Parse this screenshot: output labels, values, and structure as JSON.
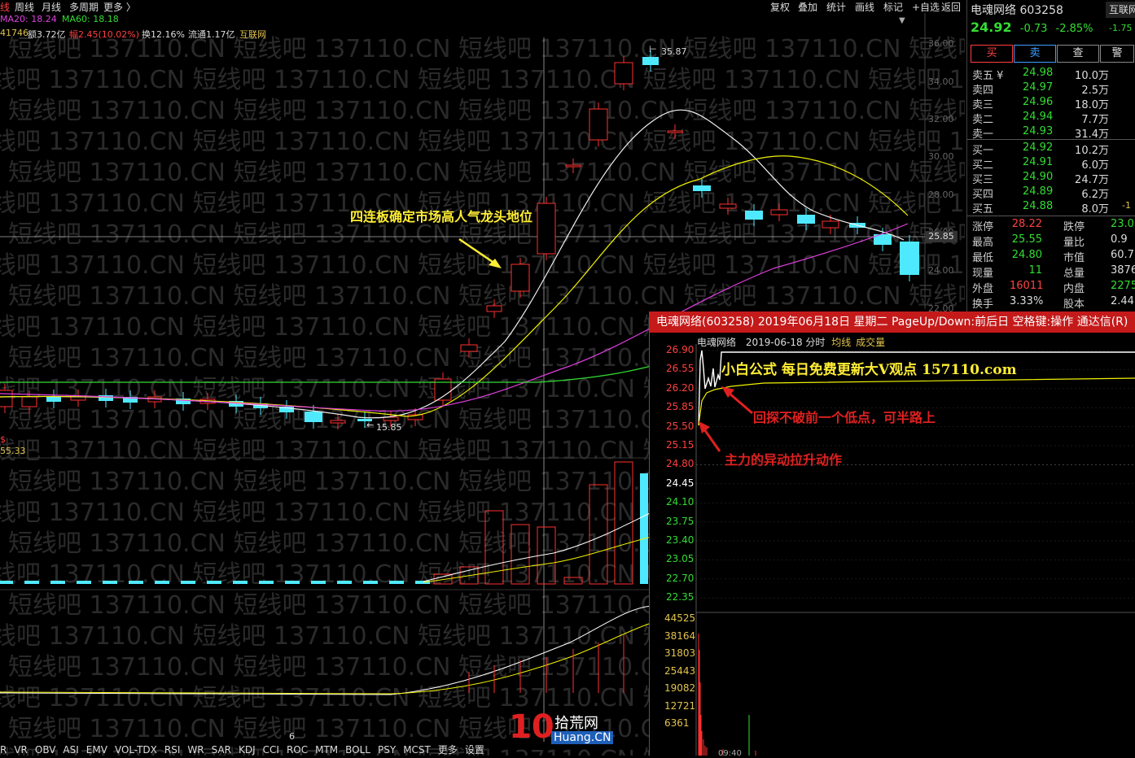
{
  "topbar": {
    "left_items": [
      "线",
      "周线",
      "月线",
      "多周期",
      "更多 〉"
    ],
    "right_items": [
      "复权",
      "叠加",
      "统计",
      "画线",
      "标记",
      "+自选",
      "返回"
    ]
  },
  "indicators": {
    "ma20_label": "MA20: 18.24",
    "ma60_label": "MA60: 18.18",
    "line2_a": "41746",
    "line2_b": "额3.72亿",
    "line2_c": "幅2.45(10.02%)",
    "line2_d": "换12.16%",
    "line2_e": "流通1.17亿",
    "line2_f": "互联网"
  },
  "annotations": {
    "headline": "四连板确定市场高人气龙头地位",
    "high_label": "35.87",
    "low_label": "15.85",
    "left_val": "55.33",
    "cross_price": "25.85",
    "small_6": "6"
  },
  "price_axis": [
    "36.00",
    "34.00",
    "32.00",
    "30.00",
    "28.00",
    "26.00",
    "24.00",
    "22.00"
  ],
  "watermark": {
    "text": "短线吧 137110.CN 短线吧 137110.CN 短线吧 137110.CN 短线吧 137110.CN 短线吧 137110.CN 短线吧"
  },
  "bottombar": [
    "R",
    "VR",
    "OBV",
    "ASI",
    "EMV",
    "VOL-TDX",
    "RSI",
    "WR",
    "SAR",
    "KDJ",
    "CCI",
    "ROC",
    "MTM",
    "BOLL",
    "PSY",
    "MCST",
    "更多",
    "设置"
  ],
  "logo": {
    "big": "10",
    "cn": "拾荒网",
    "url": "Huang.CN"
  },
  "quote": {
    "name": "电魂网络",
    "code": "603258",
    "corner": "互联网",
    "price": "24.92",
    "change": "-0.73",
    "pct": "-2.85%",
    "corner2": "-1.75",
    "buttons": [
      "买",
      "卖",
      "查",
      "警"
    ],
    "asks": [
      {
        "label": "卖五 ¥",
        "price": "24.98",
        "vol": "10.0万"
      },
      {
        "label": "卖四",
        "price": "24.97",
        "vol": "2.5万"
      },
      {
        "label": "卖三",
        "price": "24.96",
        "vol": "18.0万"
      },
      {
        "label": "卖二",
        "price": "24.94",
        "vol": "7.7万"
      },
      {
        "label": "卖一",
        "price": "24.93",
        "vol": "31.4万"
      }
    ],
    "bids": [
      {
        "label": "买一",
        "price": "24.92",
        "vol": "10.2万",
        "extra": ""
      },
      {
        "label": "买二",
        "price": "24.91",
        "vol": "6.0万",
        "extra": ""
      },
      {
        "label": "买三",
        "price": "24.90",
        "vol": "24.7万",
        "extra": ""
      },
      {
        "label": "买四",
        "price": "24.89",
        "vol": "6.2万",
        "extra": ""
      },
      {
        "label": "买五",
        "price": "24.88",
        "vol": "8.0万",
        "extra": "-1"
      }
    ],
    "stats": [
      {
        "l1": "涨停",
        "v1": "28.22",
        "c1": "red",
        "l2": "跌停",
        "v2": "23.0",
        "c2": "grn"
      },
      {
        "l1": "最高",
        "v1": "25.55",
        "c1": "grn",
        "l2": "量比",
        "v2": "0.9",
        "c2": "white"
      },
      {
        "l1": "最低",
        "v1": "24.80",
        "c1": "grn",
        "l2": "市值",
        "v2": "60.7",
        "c2": "white"
      },
      {
        "l1": "现量",
        "v1": "11",
        "c1": "grn",
        "l2": "总量",
        "v2": "3876",
        "c2": "white"
      },
      {
        "l1": "外盘",
        "v1": "16011",
        "c1": "red",
        "l2": "内盘",
        "v2": "2275",
        "c2": "grn"
      },
      {
        "l1": "换手",
        "v1": "3.33%",
        "c1": "white",
        "l2": "股本",
        "v2": "2.44",
        "c2": "white"
      }
    ]
  },
  "popup": {
    "title": "电魂网络(603258) 2019年06月18日 星期二 PageUp/Down:前后日 空格键:操作 通达信(R)",
    "sub_name": "电魂网络",
    "sub_date": "2019-06-18 分时",
    "sub_avg": "均线",
    "sub_vol": "成交量",
    "formula": "小白公式  每日免费更新大V观点  157110.com",
    "note1": "回探不破前一个低点，可半路上",
    "note2": "主力的异动拉升动作",
    "price_axis": [
      "26.90",
      "26.55",
      "26.20",
      "25.85",
      "25.50",
      "25.15",
      "24.80",
      "24.45",
      "24.10",
      "23.75",
      "23.40",
      "23.05",
      "22.70",
      "22.35"
    ],
    "vol_axis": [
      "44525",
      "38164",
      "31803",
      "25443",
      "19082",
      "12721",
      "6361"
    ],
    "time_label": "09:40"
  }
}
